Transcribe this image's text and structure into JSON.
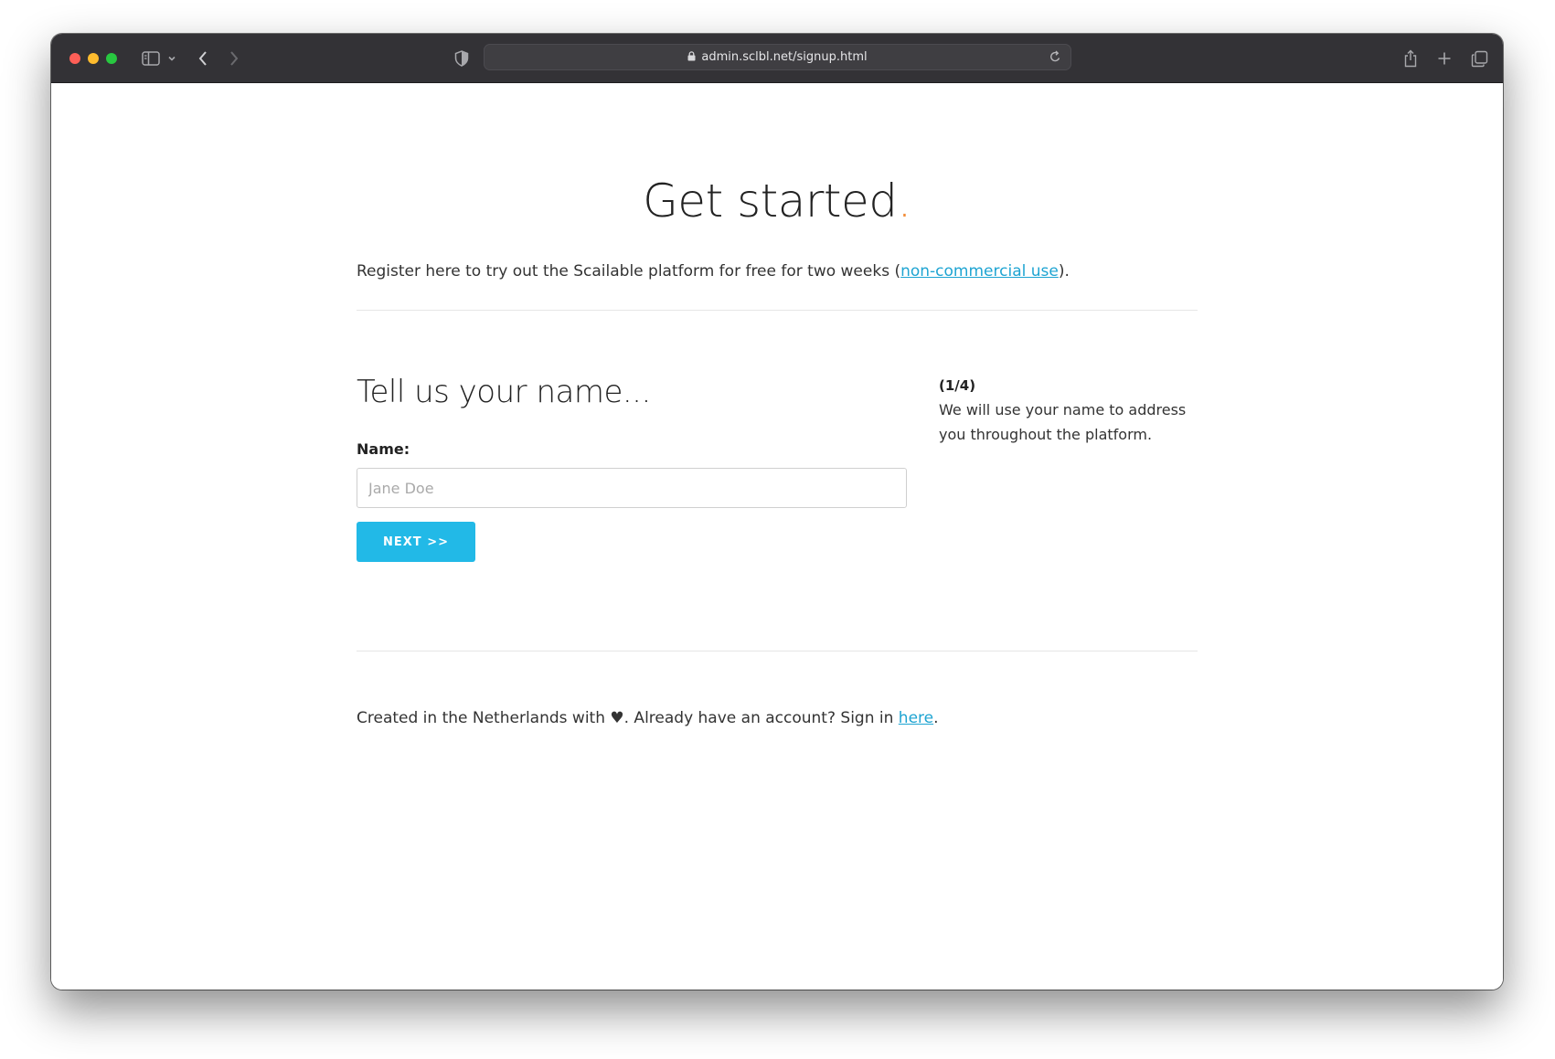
{
  "browser": {
    "url": "admin.sclbl.net/signup.html",
    "icons": [
      "close-light",
      "minimize-light",
      "zoom-light",
      "sidebar-icon",
      "chevron-down-icon",
      "back-arrow-icon",
      "forward-arrow-icon",
      "shield-icon",
      "lock-icon",
      "reload-icon",
      "share-icon",
      "new-tab-icon",
      "tab-overview-icon"
    ]
  },
  "page": {
    "title": "Get started",
    "title_dot": ".",
    "intro_prefix": "Register here to try out the Scailable platform for free for two weeks (",
    "intro_link": "non-commercial use",
    "intro_suffix": ").",
    "form_heading": "Tell us your name...",
    "name_label": "Name:",
    "name_placeholder": "Jane Doe",
    "name_value": "",
    "next_label": "NEXT >>",
    "step_indicator": "(1/4)",
    "step_help": "We will use your name to address you throughout the platform.",
    "footer_prefix": "Created in the Netherlands with ♥. Already have an account? Sign in ",
    "footer_link": "here",
    "footer_suffix": "."
  },
  "colors": {
    "accent": "#22b9e7",
    "link": "#1ea4d2",
    "title_dot": "#f28c38",
    "titlebar": "#333236"
  }
}
